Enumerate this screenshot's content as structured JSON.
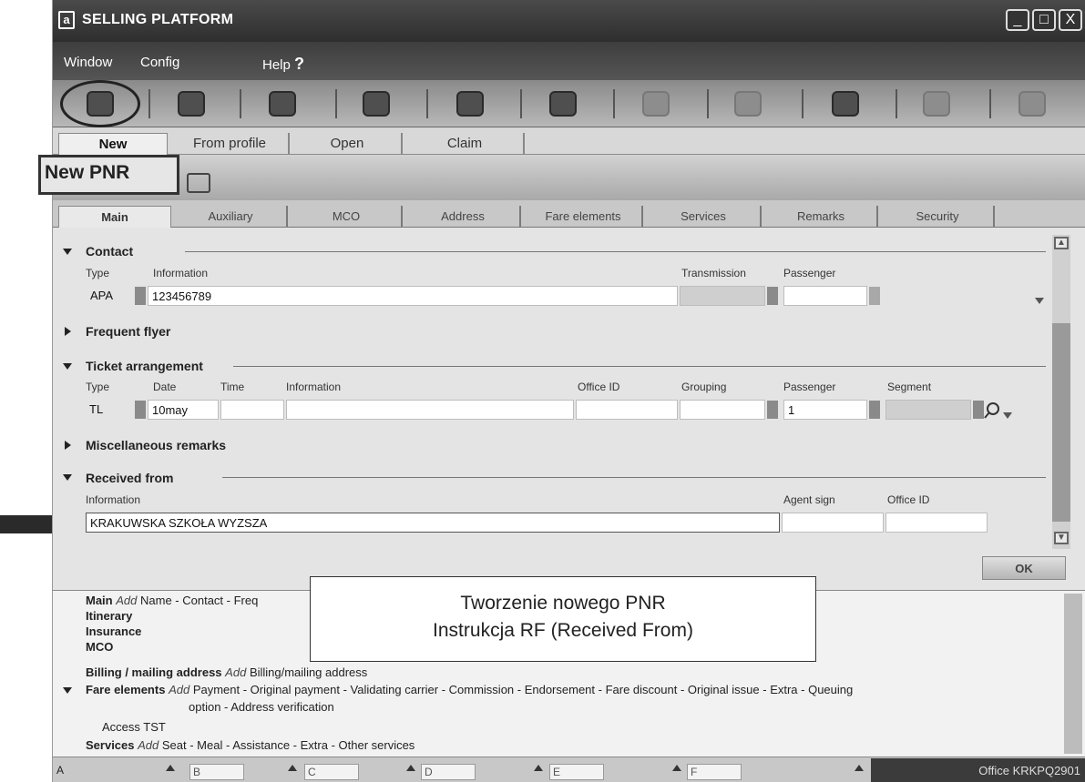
{
  "app": {
    "title": "SELLING PLATFORM",
    "logo": "a",
    "window_buttons": [
      "_",
      "□",
      "X"
    ]
  },
  "menu": {
    "window": "Window",
    "config": "Config",
    "help": "Help",
    "help_mark": "?"
  },
  "toolbar_icons": [
    "new-pnr-icon",
    "pnr-icon",
    "customer-icon",
    "queue-icon",
    "car-icon",
    "agent-icon",
    "fare-icon",
    "hotel-icon",
    "ticket-icon",
    "document-icon",
    "office-icon"
  ],
  "source_tabs": [
    "New",
    "From profile",
    "Open",
    "Claim"
  ],
  "pnr_header": {
    "title": "New PNR"
  },
  "section_tabs": [
    "Main",
    "Auxiliary",
    "MCO",
    "Address",
    "Fare elements",
    "Services",
    "Remarks",
    "Security"
  ],
  "contact": {
    "title": "Contact",
    "labels": {
      "type": "Type",
      "information": "Information",
      "transmission": "Transmission",
      "passenger": "Passenger"
    },
    "type_value": "APA",
    "information_value": "123456789"
  },
  "frequent_flyer": {
    "title": "Frequent flyer"
  },
  "ticket_arrangement": {
    "title": "Ticket arrangement",
    "labels": {
      "type": "Type",
      "date": "Date",
      "time": "Time",
      "information": "Information",
      "office_id": "Office ID",
      "grouping": "Grouping",
      "passenger": "Passenger",
      "segment": "Segment"
    },
    "type_value": "TL",
    "date_value": "10may",
    "passenger_value": "1"
  },
  "misc_remarks": {
    "title": "Miscellaneous remarks"
  },
  "received_from": {
    "title": "Received from",
    "labels": {
      "information": "Information",
      "agent_sign": "Agent sign",
      "office_id": "Office ID"
    },
    "information_value": "KRAKUWSKA SZKOŁA WYZSZA"
  },
  "ok_label": "OK",
  "caption": {
    "line1": "Tworzenie nowego PNR",
    "line2": "Instrukcja RF  (Received From)"
  },
  "summary": {
    "main": {
      "title": "Main",
      "add": "Add",
      "items": "Name - Contact - Freq"
    },
    "itinerary": "Itinerary",
    "insurance": "Insurance",
    "mco": "MCO",
    "billing": {
      "title": "Billing / mailing address",
      "add": "Add",
      "items": "Billing/mailing address"
    },
    "fare": {
      "title": "Fare elements",
      "add": "Add",
      "items": "Payment - Original payment - Validating carrier - Commission - Endorsement - Fare discount - Original issue - Extra - Queuing",
      "items2": "option - Address verification"
    },
    "access_tst": "Access TST",
    "services": {
      "title": "Services",
      "add": "Add",
      "items": "Seat - Meal - Assistance - Extra - Other services"
    }
  },
  "statusbar": {
    "a": "A",
    "b": "B",
    "c": "C",
    "d": "D",
    "e": "E",
    "f": "F",
    "office": "Office  KRKPQ2901"
  }
}
